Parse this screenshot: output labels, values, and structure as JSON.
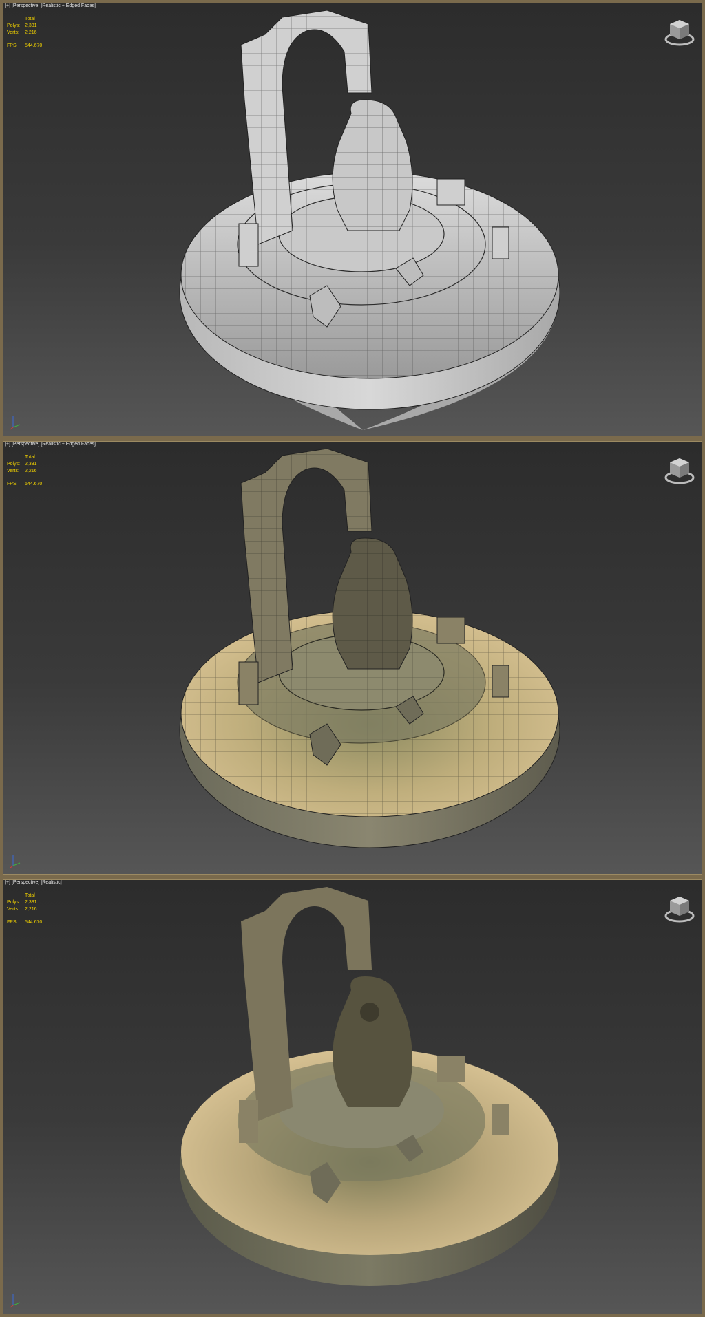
{
  "viewports": [
    {
      "label_plus": "[+]",
      "label_view": "[Perspective]",
      "label_shading": "[Realistic + Edged Faces]",
      "stats_header": "Total",
      "polys_label": "Polys:",
      "polys_value": "2,331",
      "verts_label": "Verts:",
      "verts_value": "2,216",
      "fps_label": "FPS:",
      "fps_value": "544.670"
    },
    {
      "label_plus": "[+]",
      "label_view": "[Perspective]",
      "label_shading": "[Realistic + Edged Faces]",
      "stats_header": "Total",
      "polys_label": "Polys:",
      "polys_value": "2,331",
      "verts_label": "Verts:",
      "verts_value": "2,216",
      "fps_label": "FPS:",
      "fps_value": "544.670"
    },
    {
      "label_plus": "[+]",
      "label_view": "[Perspective]",
      "label_shading": "[Realistic]",
      "stats_header": "Total",
      "polys_label": "Polys:",
      "polys_value": "2,331",
      "verts_label": "Verts:",
      "verts_value": "2,216",
      "fps_label": "FPS:",
      "fps_value": "544.670"
    }
  ],
  "icons": {
    "viewcube": "viewcube-icon",
    "axis": "axis-tripod-icon"
  },
  "colors": {
    "frame": "#7a6a4c",
    "stats_text": "#f0d000",
    "clay": "#d6d6d6",
    "sand": "#d3bd8c",
    "stone": "#6d6a55"
  }
}
